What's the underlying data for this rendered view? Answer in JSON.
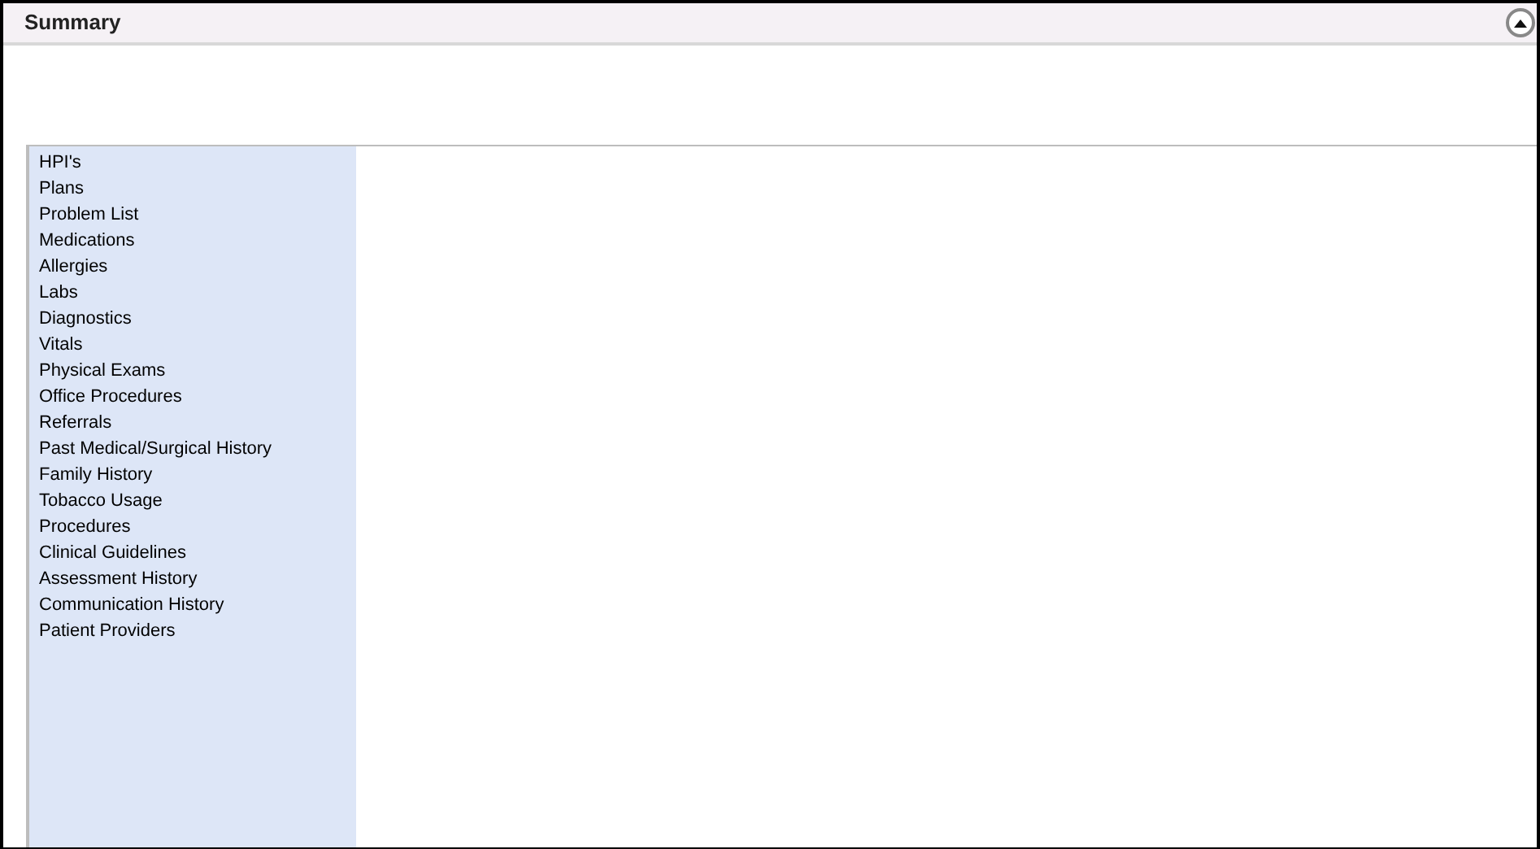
{
  "header": {
    "title": "Summary"
  },
  "sidebar": {
    "items": [
      "HPI's",
      "Plans",
      "Problem List",
      "Medications",
      "Allergies",
      "Labs",
      "Diagnostics",
      "Vitals",
      "Physical Exams",
      "Office Procedures",
      "Referrals",
      "Past Medical/Surgical History",
      "Family History",
      "Tobacco Usage",
      "Procedures",
      "Clinical Guidelines",
      "Assessment History",
      "Communication History",
      "Patient Providers"
    ]
  }
}
